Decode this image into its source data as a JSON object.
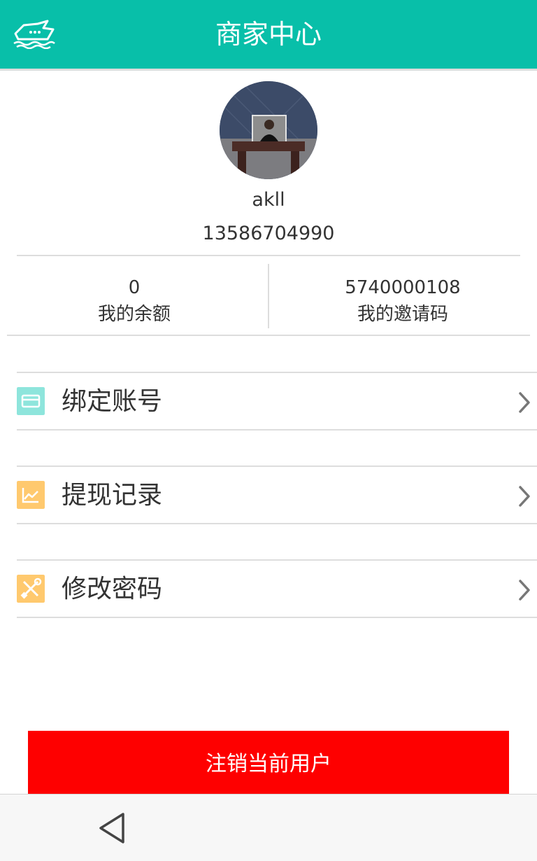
{
  "header": {
    "title": "商家中心",
    "logo_icon": "boat-logo-icon",
    "bg_color": "#08bfa9"
  },
  "profile": {
    "avatar_icon": "user-avatar-photo",
    "username": "akll",
    "phone": "13586704990"
  },
  "stats": {
    "balance_value": "0",
    "balance_label": "我的余额",
    "invite_value": "5740000108",
    "invite_label": "我的邀请码"
  },
  "menu": {
    "items": [
      {
        "label": "绑定账号",
        "icon": "card-icon",
        "color": "#8ee5dc"
      },
      {
        "label": "提现记录",
        "icon": "chart-line-icon",
        "color": "#ffc96e"
      },
      {
        "label": "修改密码",
        "icon": "tools-icon",
        "color": "#ffc96e"
      }
    ]
  },
  "logout": {
    "label": "注销当前用户",
    "color": "#fe0000"
  },
  "system_nav": {
    "back_icon": "back-triangle-icon"
  }
}
